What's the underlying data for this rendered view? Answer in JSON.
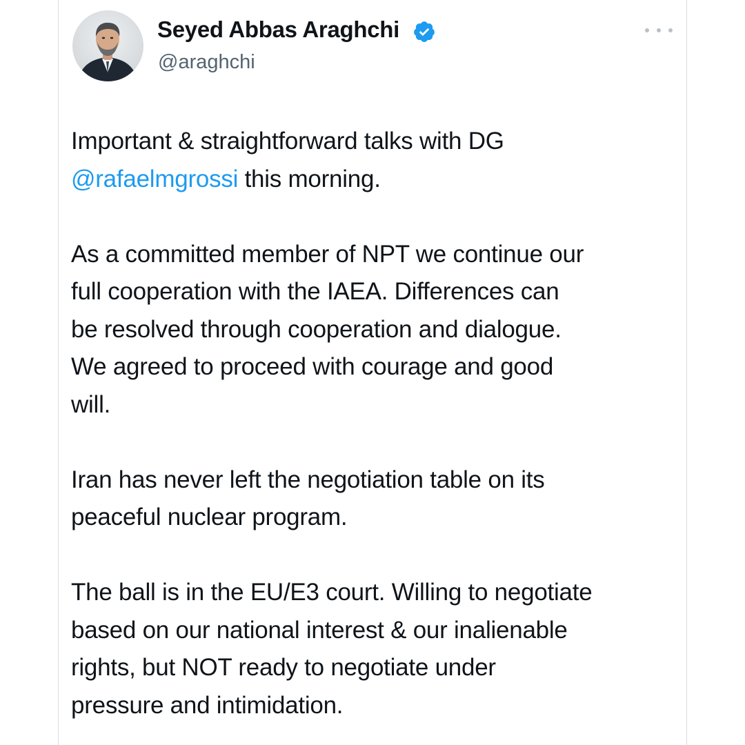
{
  "tweet": {
    "author": {
      "display_name": "Seyed Abbas Araghchi",
      "handle": "@araghchi",
      "verified_icon": "verified-badge-icon",
      "avatar_icon": "profile-photo"
    },
    "more_icon": "more-options-icon",
    "accent_color": "#1d9bf0",
    "text": {
      "p1_line1": "Important & straightforward talks with DG",
      "p1_mention": "@rafaelmgrossi",
      "p1_rest": " this morning.",
      "p2_lines": [
        "As a committed member of NPT we continue our",
        "full cooperation with the IAEA. Differences can",
        "be resolved through cooperation and dialogue.",
        "We agreed to proceed with courage and good",
        "will."
      ],
      "p3_lines": [
        "Iran has never left the negotiation table on its",
        "peaceful nuclear program."
      ],
      "p4_lines": [
        "The ball is in the EU/E3 court. Willing to negotiate",
        "based on our national interest & our inalienable",
        "rights, but NOT ready to negotiate under",
        "pressure and intimidation."
      ]
    }
  }
}
